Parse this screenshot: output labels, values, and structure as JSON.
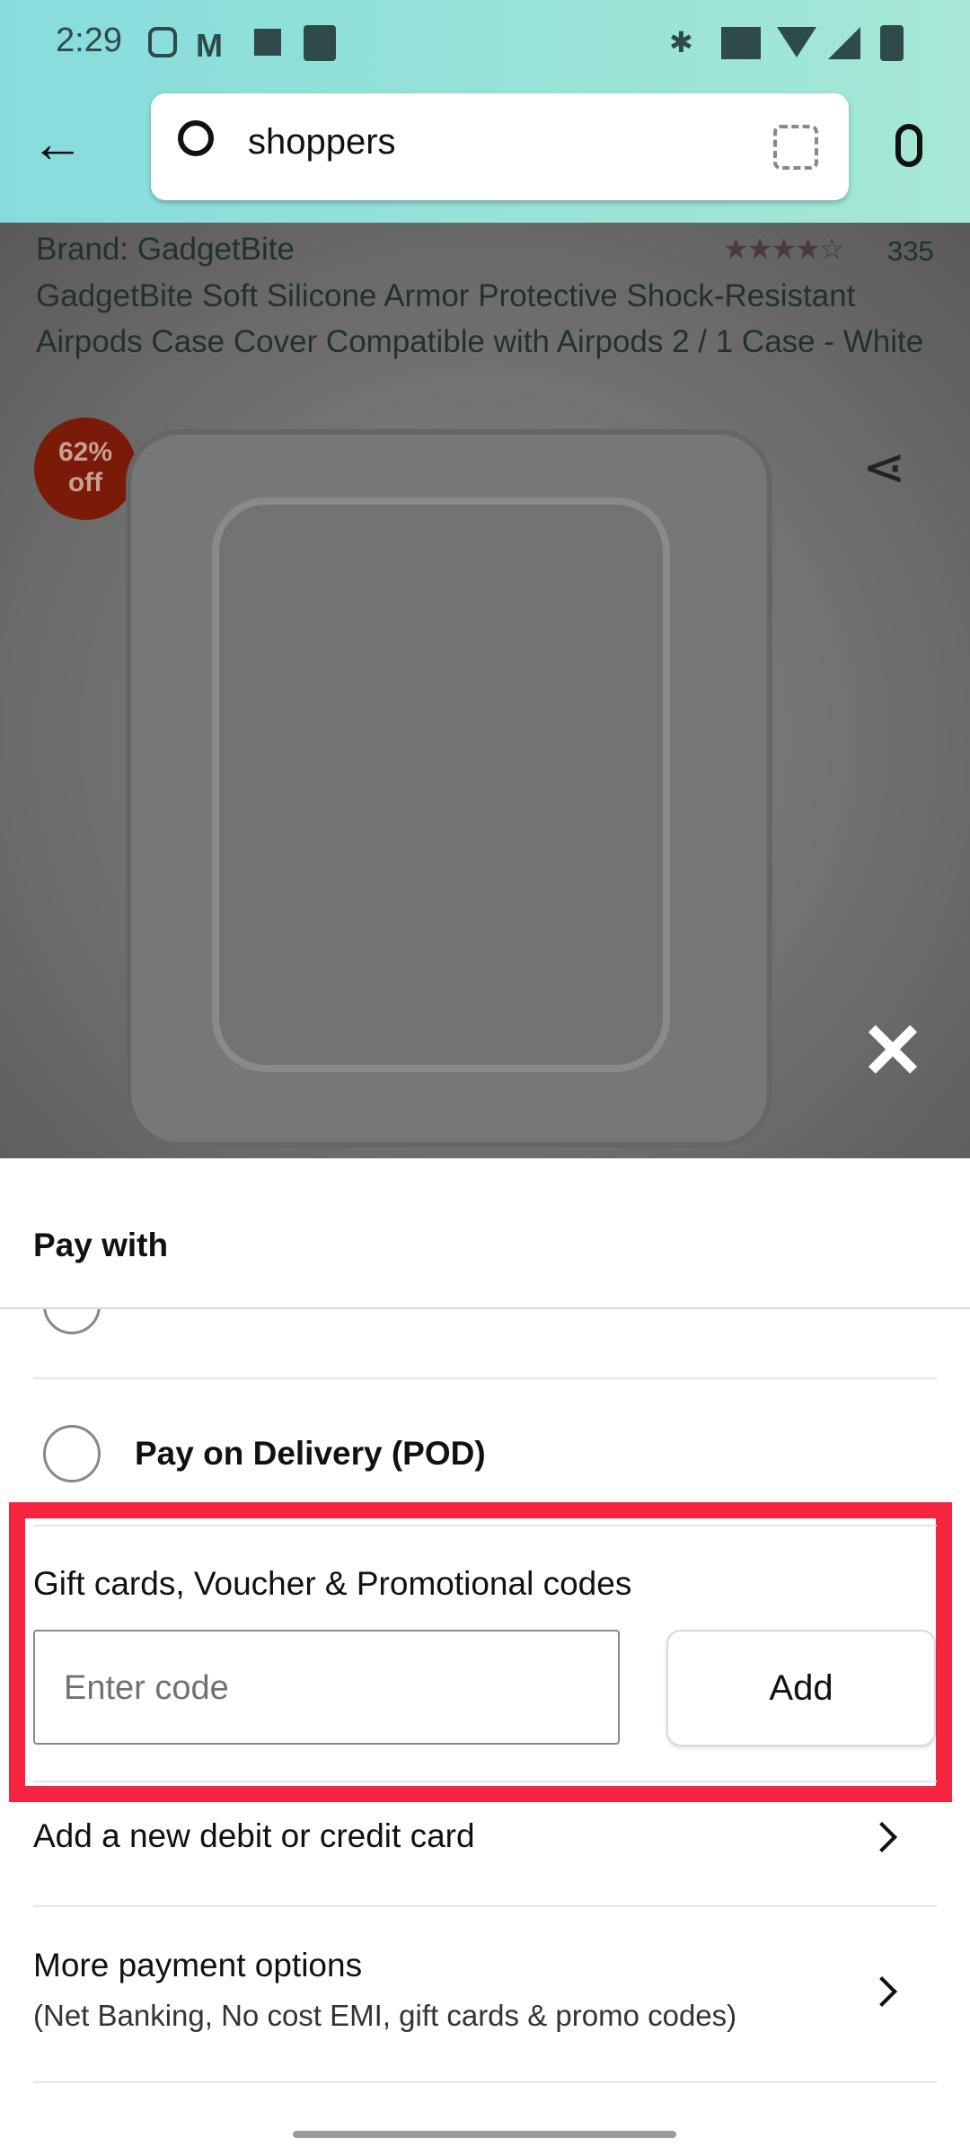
{
  "status_bar": {
    "time": "2:29",
    "icons": [
      "instagram-icon",
      "gmail-icon",
      "gallery-icon",
      "task-icon",
      "bluetooth-icon",
      "vowifi-icon",
      "wifi-icon",
      "signal-icon",
      "battery-icon"
    ]
  },
  "header": {
    "search_value": "shoppers"
  },
  "product": {
    "brand": "Brand: GadgetBite",
    "rating_count": "335",
    "rating": 4.5,
    "title": "GadgetBite Soft Silicone Armor Protective Shock-Resistant Airpods Case Cover Compatible with Airpods 2 / 1 Case - White",
    "discount_pct": "62%",
    "discount_off": "off"
  },
  "sheet": {
    "title": "Pay with",
    "pod_label": "Pay on Delivery (POD)",
    "gift_label": "Gift cards, Voucher & Promotional codes",
    "code_placeholder": "Enter code",
    "add_label": "Add",
    "new_card": "Add a new debit or credit card",
    "more_options": "More payment options",
    "more_options_sub": "(Net Banking, No cost EMI, gift cards & promo codes)"
  },
  "colors": {
    "highlight": "#f5253f",
    "header_start": "#86dcdc",
    "header_end": "#a6e8d6",
    "badge": "#7a1a08"
  }
}
